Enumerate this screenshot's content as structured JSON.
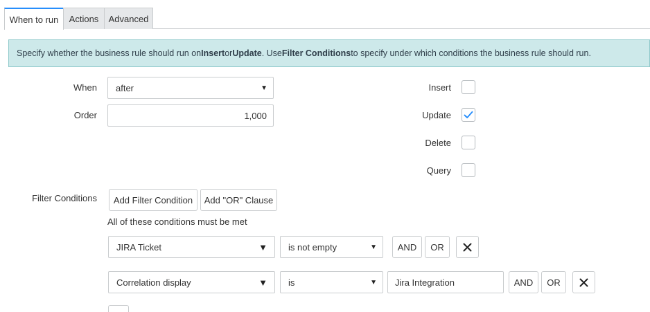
{
  "tabs": [
    {
      "label": "When to run",
      "active": true
    },
    {
      "label": "Actions",
      "active": false
    },
    {
      "label": "Advanced",
      "active": false
    }
  ],
  "banner": {
    "part1": "Specify whether the business rule should run on ",
    "insert": "Insert",
    "or": " or ",
    "update": "Update",
    "part2": ". Use ",
    "filter_conditions": "Filter Conditions",
    "part3": " to specify under which conditions the business rule should run."
  },
  "form": {
    "when_label": "When",
    "when_value": "after",
    "order_label": "Order",
    "order_value": "1,000",
    "insert_label": "Insert",
    "insert_checked": false,
    "update_label": "Update",
    "update_checked": true,
    "delete_label": "Delete",
    "delete_checked": false,
    "query_label": "Query",
    "query_checked": false
  },
  "filter": {
    "label": "Filter Conditions",
    "add_condition": "Add Filter Condition",
    "add_or": "Add \"OR\" Clause",
    "summary": "All of these conditions must be met",
    "conditions": [
      {
        "field": "JIRA Ticket",
        "operator": "is not empty",
        "value": null,
        "and": "AND",
        "or": "OR"
      },
      {
        "field": "Correlation display",
        "operator": "is",
        "value": "Jira Integration",
        "and": "AND",
        "or": "OR"
      }
    ]
  },
  "colors": {
    "accent": "#278efc",
    "banner_bg": "#cde9ea",
    "banner_border": "#8fc9cb",
    "check": "#278efc"
  },
  "icons": {
    "caret": "▼",
    "remove": "close-icon",
    "check": "checkmark-icon"
  }
}
